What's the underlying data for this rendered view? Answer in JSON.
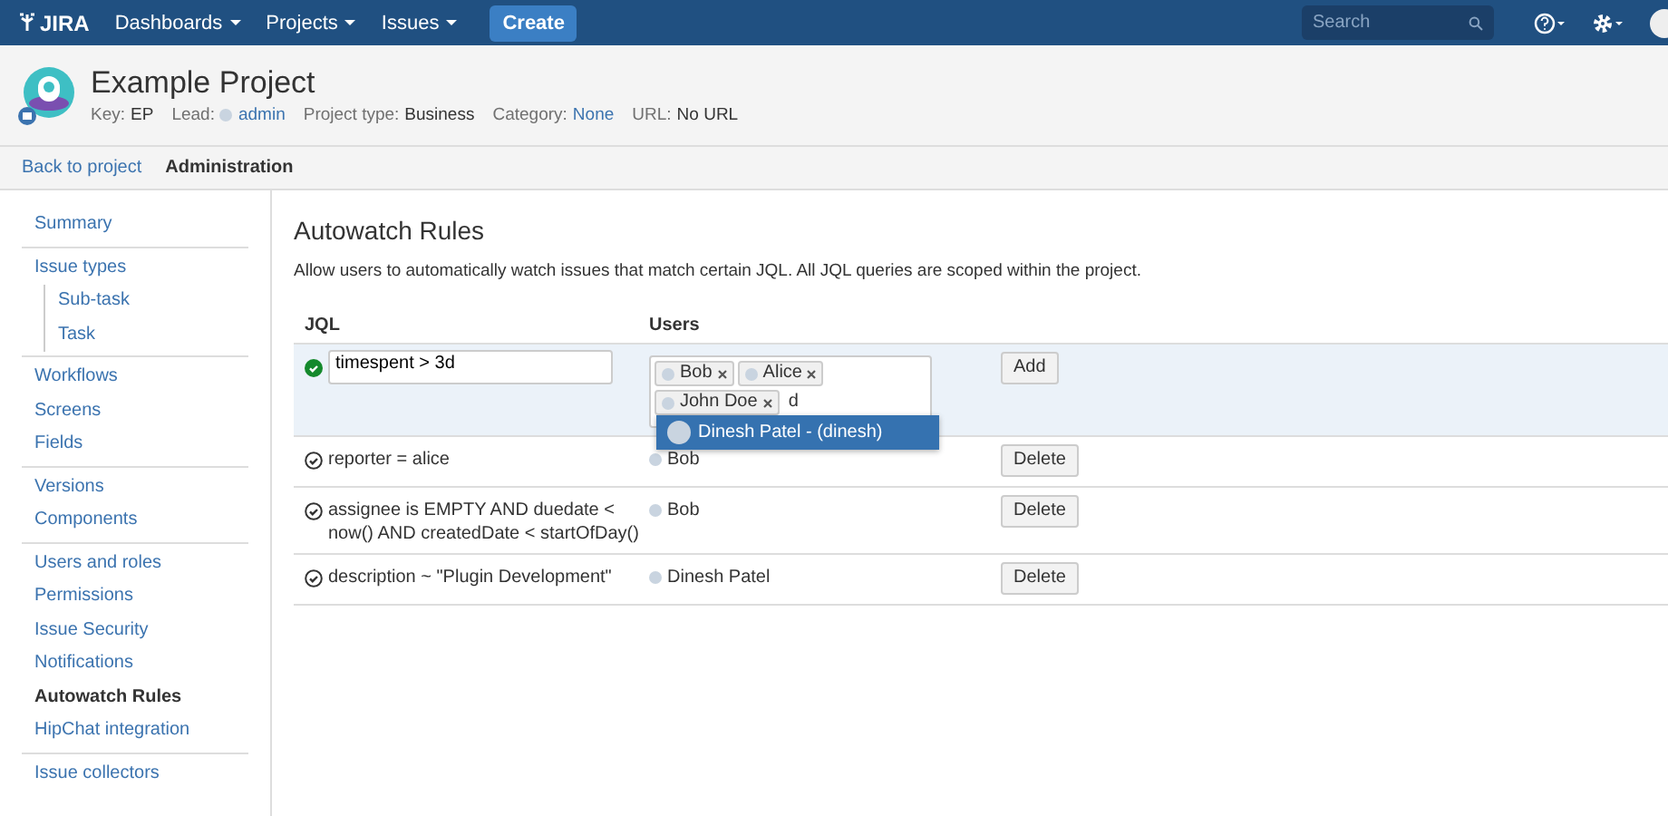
{
  "nav": {
    "logo": "JIRA",
    "menus": [
      "Dashboards",
      "Projects",
      "Issues"
    ],
    "create": "Create",
    "search": {
      "placeholder": "Search"
    }
  },
  "project": {
    "name": "Example Project",
    "meta": [
      {
        "label": "Key:",
        "value": "EP",
        "kind": "text"
      },
      {
        "label": "Lead:",
        "value": "admin",
        "kind": "user"
      },
      {
        "label": "Project type:",
        "value": "Business",
        "kind": "text"
      },
      {
        "label": "Category:",
        "value": "None",
        "kind": "link"
      },
      {
        "label": "URL:",
        "value": "No URL",
        "kind": "text"
      }
    ]
  },
  "tabs": [
    {
      "label": "Back to project",
      "selected": false
    },
    {
      "label": "Administration",
      "selected": true
    }
  ],
  "sidebar": {
    "groups": [
      [
        {
          "label": "Summary",
          "selected": false
        }
      ],
      [
        {
          "label": "Issue types",
          "selected": false,
          "children": [
            {
              "label": "Sub-task",
              "selected": false
            },
            {
              "label": "Task",
              "selected": false
            }
          ]
        }
      ],
      [
        {
          "label": "Workflows",
          "selected": false
        },
        {
          "label": "Screens",
          "selected": false
        },
        {
          "label": "Fields",
          "selected": false
        }
      ],
      [
        {
          "label": "Versions",
          "selected": false
        },
        {
          "label": "Components",
          "selected": false
        }
      ],
      [
        {
          "label": "Users and roles",
          "selected": false
        },
        {
          "label": "Permissions",
          "selected": false
        },
        {
          "label": "Issue Security",
          "selected": false
        },
        {
          "label": "Notifications",
          "selected": false
        },
        {
          "label": "Autowatch Rules",
          "selected": true
        },
        {
          "label": "HipChat integration",
          "selected": false
        }
      ],
      [
        {
          "label": "Issue collectors",
          "selected": false
        }
      ]
    ]
  },
  "page": {
    "title": "Autowatch Rules",
    "description": "Allow users to automatically watch issues that match certain JQL. All JQL queries are scoped within the project."
  },
  "table": {
    "columns": [
      "JQL",
      "Users"
    ],
    "new_rule": {
      "jql": "timespent > 3d",
      "valid": true,
      "users": [
        "Bob",
        "Alice",
        "John Doe"
      ],
      "query": "d",
      "suggestions": [
        {
          "label": "Dinesh Patel - (dinesh)",
          "selected": true
        }
      ],
      "button": "Add"
    },
    "rows": [
      {
        "jql": "reporter = alice",
        "users": "Bob",
        "button": "Delete"
      },
      {
        "jql": "assignee is EMPTY AND duedate < now() AND createdDate < startOfDay()",
        "users": "Bob",
        "button": "Delete"
      },
      {
        "jql": "description ~ \"Plugin Development\"",
        "users": "Dinesh Patel",
        "button": "Delete"
      }
    ]
  }
}
